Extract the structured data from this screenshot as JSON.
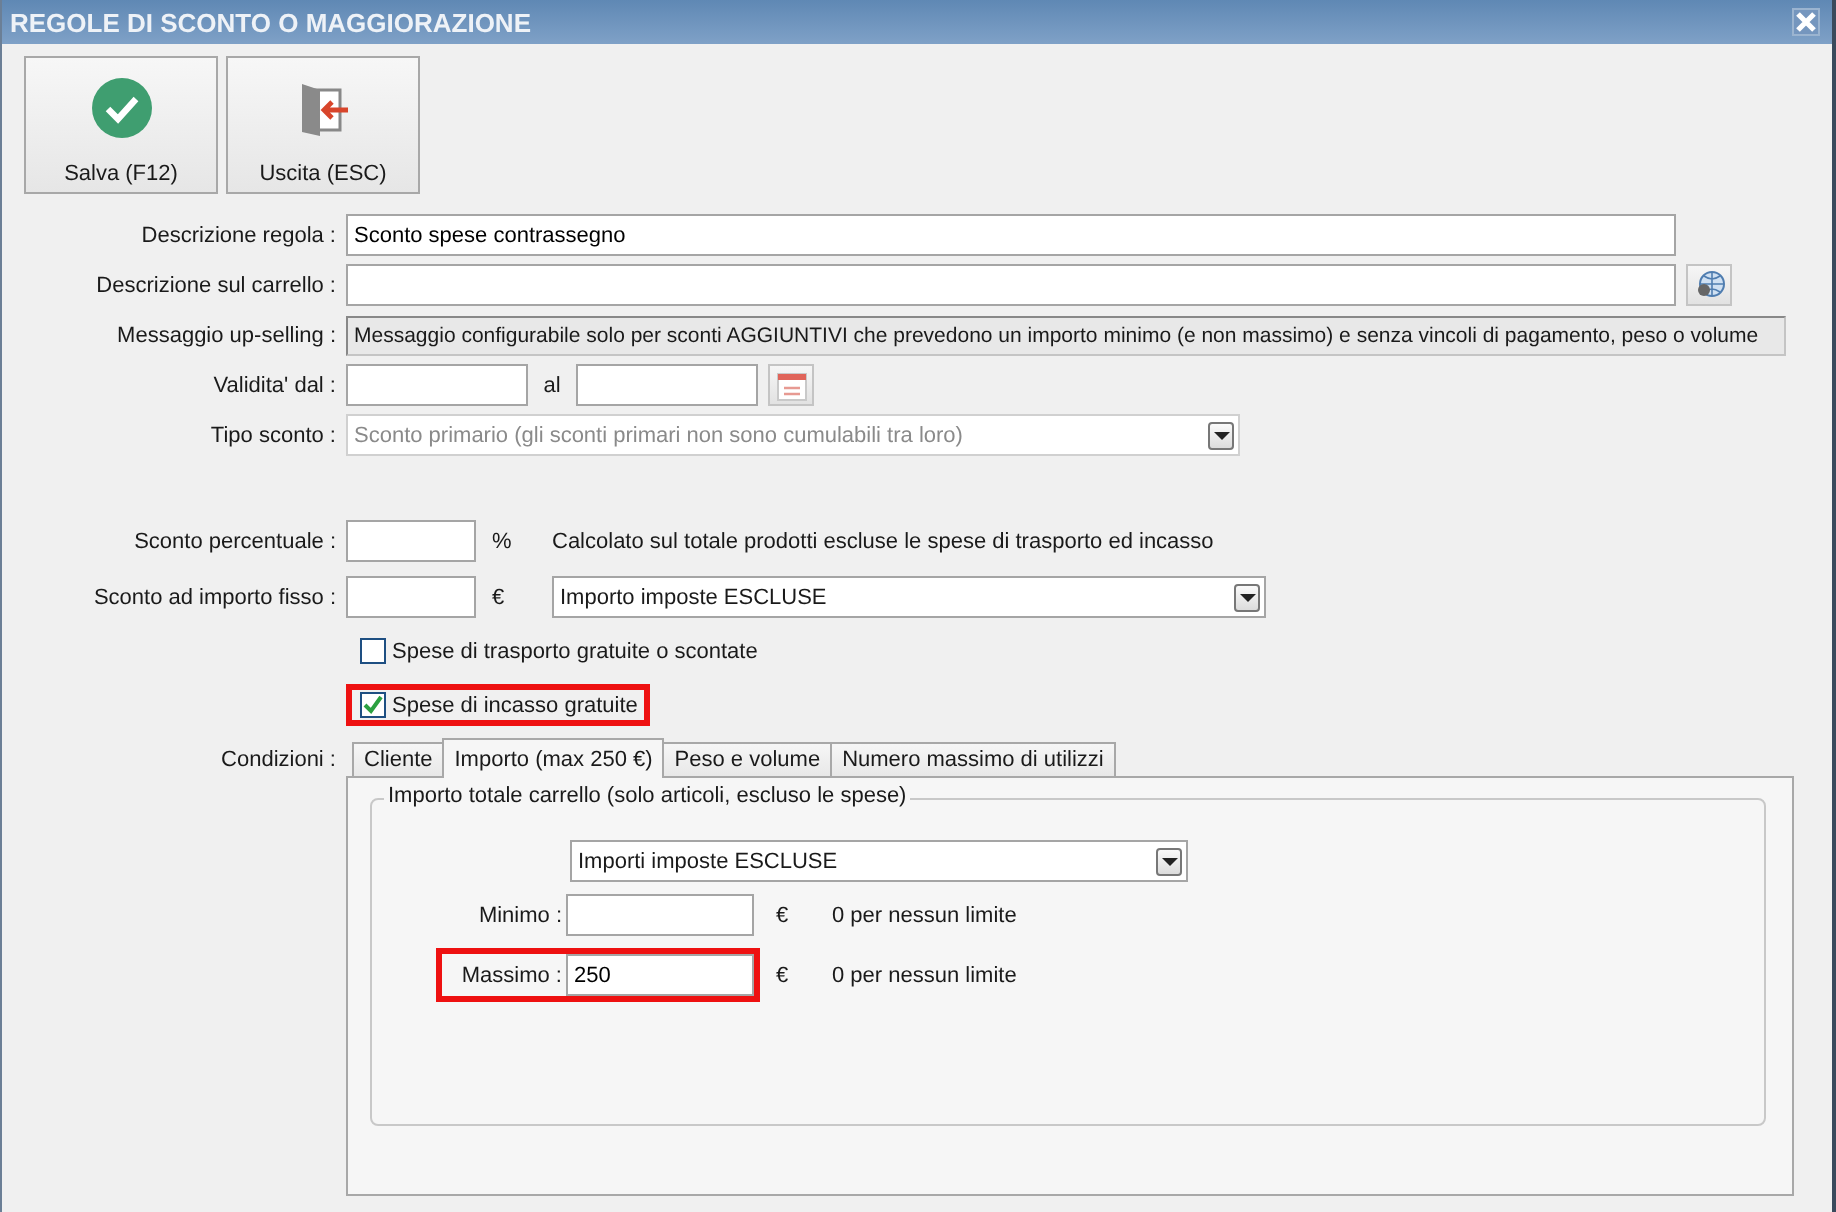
{
  "window": {
    "title": "REGOLE DI SCONTO O MAGGIORAZIONE"
  },
  "toolbar": [
    {
      "kind": "save",
      "label": "Salva (F12)"
    },
    {
      "kind": "exit",
      "label": "Uscita (ESC)"
    }
  ],
  "fields": [
    {
      "kind": "text",
      "label": "Descrizione regola :",
      "value": "Sconto spese contrassegno"
    },
    {
      "kind": "text_globe",
      "label": "Descrizione sul carrello :"
    },
    {
      "kind": "message",
      "label": "Messaggio up-selling :",
      "value": "Messaggio configurabile solo per sconti AGGIUNTIVI che prevedono un importo minimo (e non massimo) e senza vincoli di pagamento, peso o volume"
    },
    {
      "kind": "date_range",
      "label": "Validita' dal :",
      "separator": "al"
    },
    {
      "kind": "select",
      "label": "Tipo sconto :",
      "value": "Sconto primario (gli sconti primari non sono cumulabili tra loro)",
      "disabled": true
    }
  ],
  "discounts": [
    {
      "kind": "percent",
      "label": "Sconto percentuale :",
      "unit": "%",
      "note": "Calcolato sul totale prodotti escluse le spese di trasporto ed incasso"
    },
    {
      "kind": "fixed",
      "label": "Sconto ad importo fisso :",
      "unit": "€",
      "select": "Importo imposte ESCLUSE"
    }
  ],
  "checkboxes": [
    {
      "label": "Spese di trasporto gratuite o scontate",
      "checked": false,
      "highlighted": false
    },
    {
      "label": "Spese di incasso gratuite",
      "checked": true,
      "highlighted": true
    }
  ],
  "conditions": {
    "label": "Condizioni :",
    "tabs": [
      {
        "label": "Cliente",
        "selected": false
      },
      {
        "label": "Importo (max 250 €)",
        "selected": true
      },
      {
        "label": "Peso e volume",
        "selected": false
      },
      {
        "label": "Numero massimo di utilizzi",
        "selected": false
      }
    ],
    "group": {
      "title": "Importo totale carrello (solo articoli, escluso le spese)",
      "select": "Importi imposte ESCLUSE",
      "fields": [
        {
          "label": "Minimo :",
          "unit": "€",
          "hint": "0 per nessun limite",
          "highlighted": false
        },
        {
          "label": "Massimo :",
          "value": "250",
          "unit": "€",
          "hint": "0 per nessun limite",
          "highlighted": true
        }
      ]
    }
  }
}
